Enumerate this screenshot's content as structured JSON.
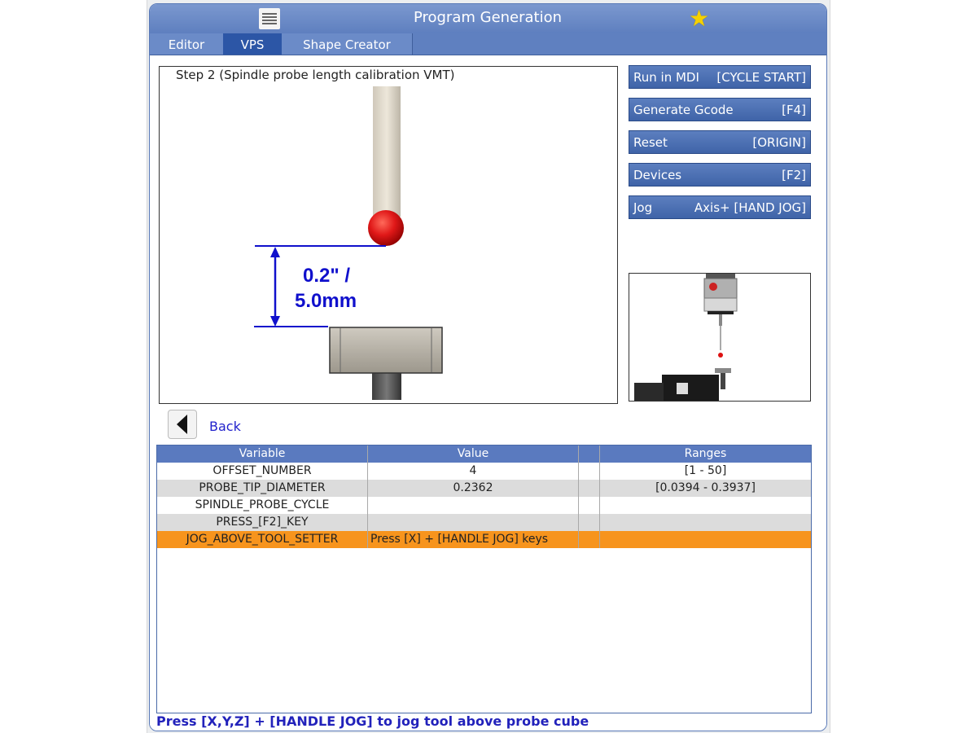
{
  "window": {
    "title": "Program Generation"
  },
  "tabs": [
    {
      "label": "Editor"
    },
    {
      "label": "VPS"
    },
    {
      "label": "Shape Creator"
    }
  ],
  "step": {
    "label": "Step 2 (Spindle probe length calibration VMT)",
    "dimension_line1": "0.2\" /",
    "dimension_line2": "5.0mm"
  },
  "actions": [
    {
      "label": "Run in MDI",
      "key": "[CYCLE START]"
    },
    {
      "label": "Generate Gcode",
      "key": "[F4]"
    },
    {
      "label": "Reset",
      "key": "[ORIGIN]"
    },
    {
      "label": "Devices",
      "key": "[F2]"
    },
    {
      "label": "Jog",
      "key": "Axis+ [HAND JOG]"
    }
  ],
  "back": {
    "label": "Back"
  },
  "table": {
    "headers": [
      "Variable",
      "Value",
      "",
      "Ranges"
    ],
    "rows": [
      {
        "variable": "OFFSET_NUMBER",
        "value": "4",
        "extra": "",
        "range": "[1 - 50]"
      },
      {
        "variable": "PROBE_TIP_DIAMETER",
        "value": "0.2362",
        "extra": "",
        "range": "[0.0394 - 0.3937]"
      },
      {
        "variable": "SPINDLE_PROBE_CYCLE",
        "value": "",
        "extra": "",
        "range": ""
      },
      {
        "variable": "PRESS_[F2]_KEY",
        "value": "",
        "extra": "",
        "range": ""
      },
      {
        "variable": "JOG_ABOVE_TOOL_SETTER",
        "value": "Press [X] + [HANDLE JOG] keys",
        "extra": "",
        "range": ""
      }
    ]
  },
  "status": "Press [X,Y,Z] + [HANDLE JOG] to jog tool above probe cube",
  "colors": {
    "title_bar": "#6b8bc8",
    "active_tab": "#2c56a6",
    "highlight_row": "#f7941d",
    "status_text": "#2222bb",
    "probe_tip": "#d01010"
  },
  "icons": {
    "menu": "hamburger-icon",
    "favorite": "star-icon",
    "back": "left-arrow-icon"
  }
}
